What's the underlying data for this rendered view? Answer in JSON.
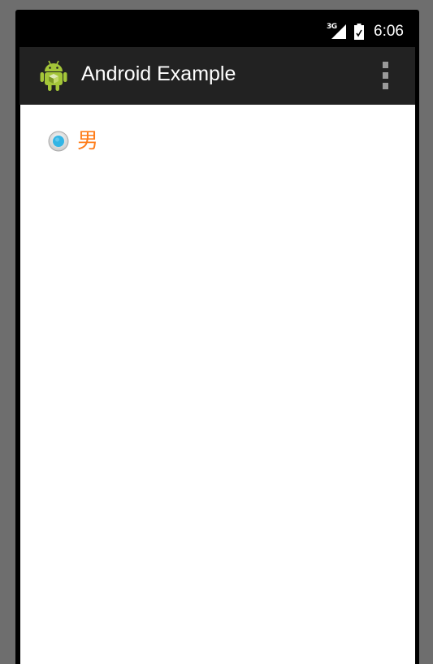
{
  "status_bar": {
    "network_type": "3G",
    "time": "6:06",
    "icons": [
      "signal-icon",
      "battery-icon"
    ]
  },
  "action_bar": {
    "title": "Android Example",
    "logo_icon": "android-logo-icon",
    "menu_icon": "overflow-menu-icon"
  },
  "radio": {
    "label": "男",
    "checked": true,
    "accent_color": "#33b5e5",
    "label_color": "#ff7d1a"
  },
  "colors": {
    "action_bar_bg": "#222222",
    "content_bg": "#ffffff",
    "frame_bg": "#6e6e6e"
  }
}
